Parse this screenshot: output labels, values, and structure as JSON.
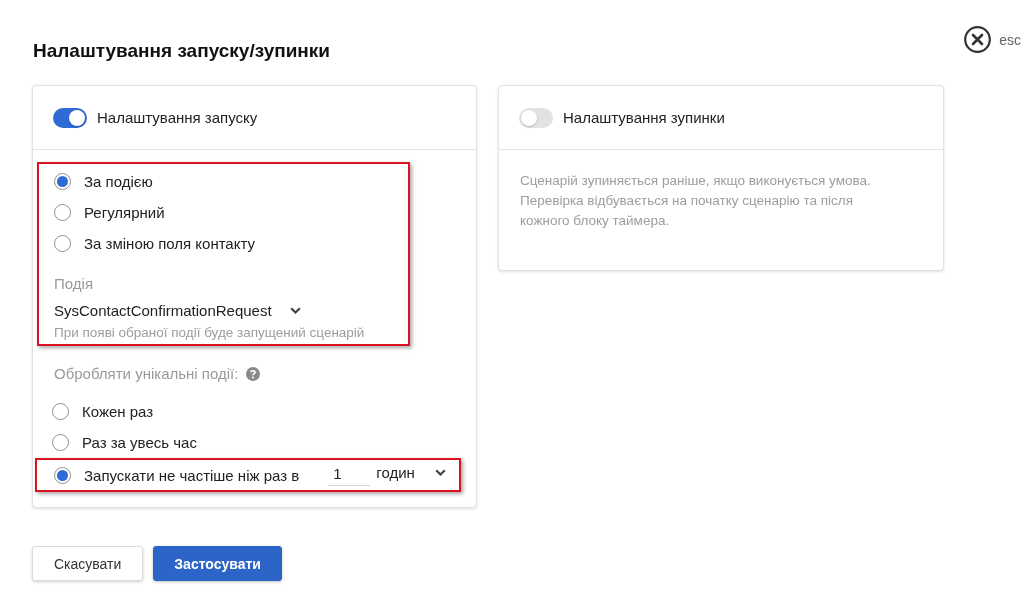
{
  "dialog": {
    "title": "Налаштування запуску/зупинки",
    "close_label": "esc"
  },
  "start_panel": {
    "toggle": {
      "label": "Налаштування запуску",
      "on": true
    },
    "trigger": {
      "highlighted": true,
      "options": [
        {
          "label": "За подією",
          "selected": true
        },
        {
          "label": "Регулярний",
          "selected": false
        },
        {
          "label": "За зміною поля контакту",
          "selected": false
        }
      ],
      "event_field": {
        "label": "Подія",
        "value": "SysContactConfirmationRequest",
        "hint": "При появі обраної події буде запущений сценарій"
      }
    },
    "unique_events": {
      "label": "Обробляти унікальні події:",
      "options": [
        {
          "kind": "plain",
          "label": "Кожен раз",
          "selected": false,
          "highlighted": false
        },
        {
          "kind": "plain",
          "label": "Раз за увесь час",
          "selected": false,
          "highlighted": false
        },
        {
          "kind": "interval",
          "label": "Запускати не частіше ніж раз в",
          "selected": true,
          "highlighted": true,
          "value": "1",
          "unit": "годин"
        }
      ]
    }
  },
  "stop_panel": {
    "toggle": {
      "label": "Налаштування зупинки",
      "on": false
    },
    "description": "Сценарій зупиняється раніше, якщо виконується умова. Перевірка відбувається на початку сценарію та після кожного блоку таймера."
  },
  "buttons": [
    {
      "kind": "secondary",
      "label": "Скасувати"
    },
    {
      "kind": "primary",
      "label": "Застосувати"
    }
  ]
}
